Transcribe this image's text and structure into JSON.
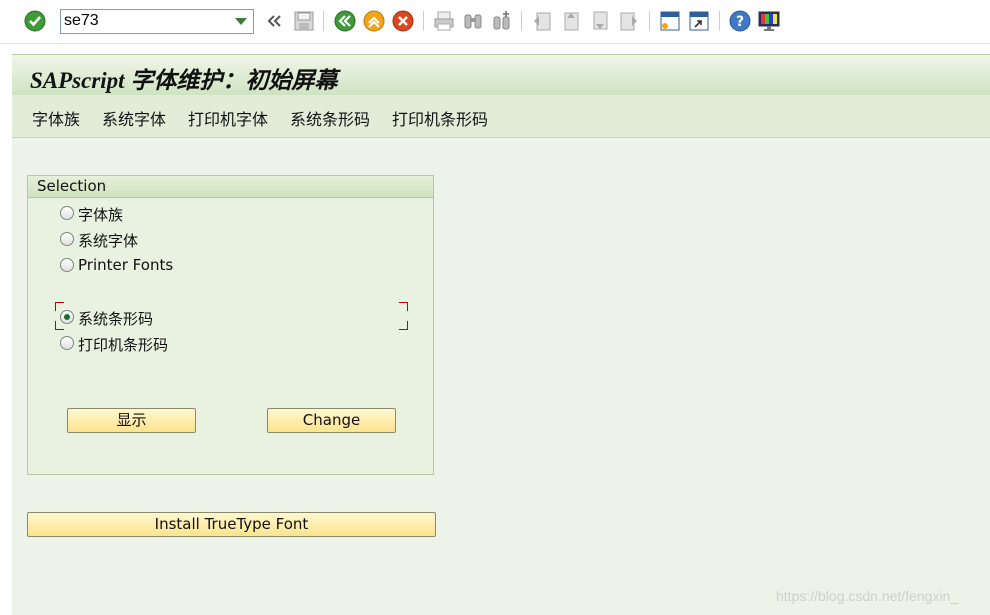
{
  "toolbar": {
    "command_value": "se73",
    "icons": [
      "enter-icon",
      "back-double-icon",
      "save-icon",
      "back-icon",
      "exit-icon",
      "cancel-icon",
      "print-icon",
      "find-icon",
      "find-next-icon",
      "first-page-icon",
      "prev-page-icon",
      "next-page-icon",
      "last-page-icon",
      "create-session-icon",
      "shortcut-icon",
      "help-icon",
      "customize-layout-icon"
    ]
  },
  "title": "SAPscript 字体维护：初始屏幕",
  "menu": [
    "字体族",
    "系统字体",
    "打印机字体",
    "系统条形码",
    "打印机条形码"
  ],
  "selection": {
    "header": "Selection",
    "options": [
      {
        "label": "字体族",
        "checked": false
      },
      {
        "label": "系统字体",
        "checked": false
      },
      {
        "label": "Printer Fonts",
        "checked": false
      },
      {
        "label": "系统条形码",
        "checked": true
      },
      {
        "label": "打印机条形码",
        "checked": false
      }
    ],
    "display_button": "显示",
    "change_button": "Change"
  },
  "install_button": "Install TrueType Font",
  "watermark": "https://blog.csdn.net/fengxin_",
  "colors": {
    "accent_green": "#1e6d2d",
    "button_yellow": "#fde38c",
    "panel_bg": "#eef3e9",
    "title_bg": "#cfe3c2",
    "focus_red": "#bb0000"
  }
}
